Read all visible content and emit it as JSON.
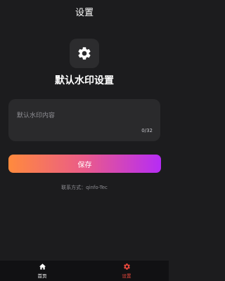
{
  "header": {
    "title": "设置"
  },
  "icons": {
    "settings": "gear-icon",
    "home_tab": "home-icon",
    "settings_tab": "gear-icon"
  },
  "page": {
    "heading": "默认水印设置"
  },
  "watermark": {
    "value": "",
    "placeholder": "默认水印内容",
    "counter": "0/32"
  },
  "actions": {
    "save_label": "保存"
  },
  "contact": {
    "text": "联系方式：qinfo-Tec"
  },
  "tabbar": {
    "items": [
      {
        "label": "首页",
        "icon": "home-icon",
        "active": false
      },
      {
        "label": "设置",
        "icon": "gear-icon",
        "active": true
      }
    ]
  },
  "colors": {
    "background": "#1c1c1e",
    "card": "#2a2a2c",
    "accent_active": "#e8483c",
    "gradient_start": "#ff8a3d",
    "gradient_end": "#b62cf5"
  }
}
